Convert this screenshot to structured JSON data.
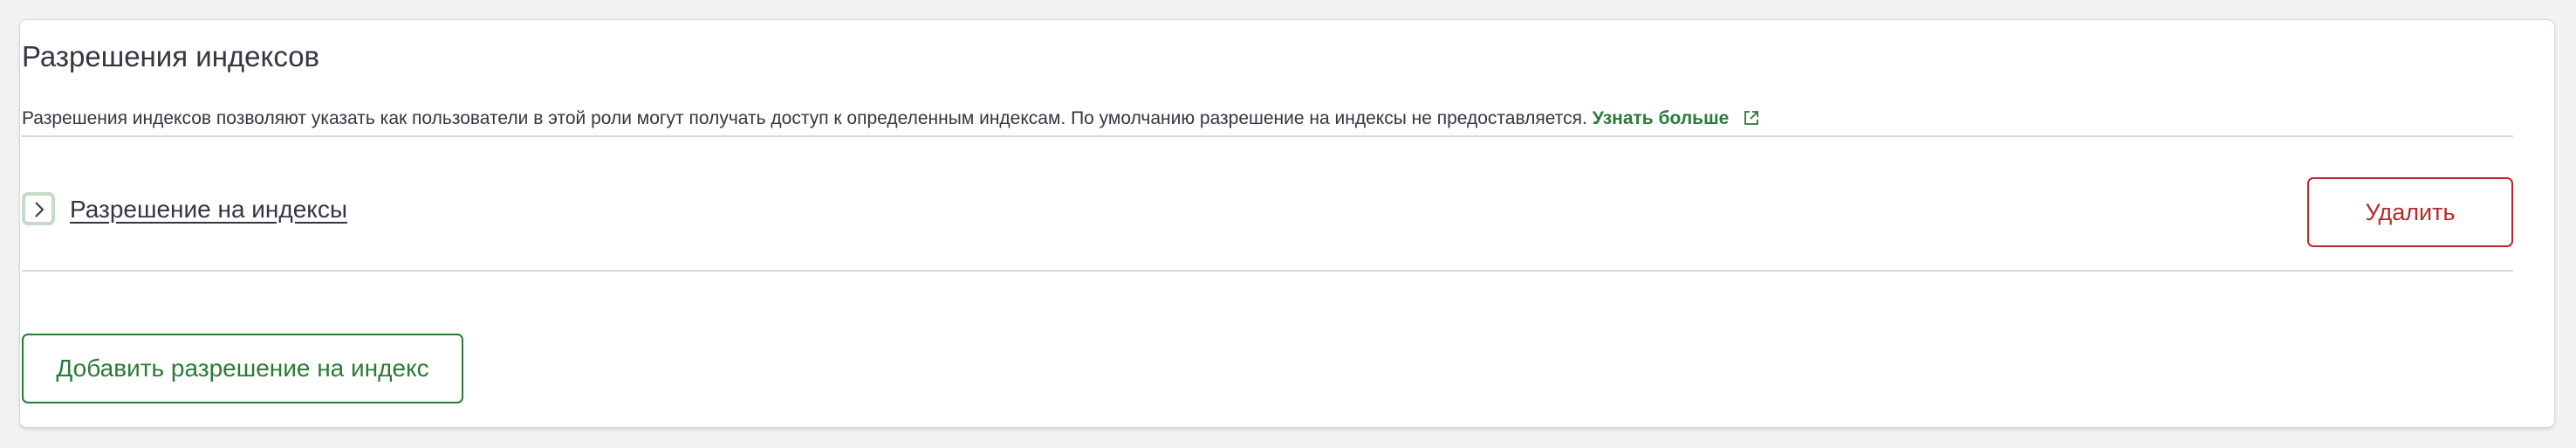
{
  "section": {
    "title": "Разрешения индексов",
    "description": "Разрешения индексов позволяют указать как пользователи в этой роли могут получать доступ к определенным индексам. По умолчанию разрешение на индексы не предоставляется.",
    "learn_more": "Узнать больше"
  },
  "permission": {
    "label": "Разрешение на индексы",
    "toggle_icon": "chevron-right-icon"
  },
  "buttons": {
    "delete": "Удалить",
    "add": "Добавить разрешение на индекс"
  },
  "colors": {
    "accent_green": "#2b7a36",
    "danger_red": "#b42a2a",
    "text": "#343741"
  }
}
